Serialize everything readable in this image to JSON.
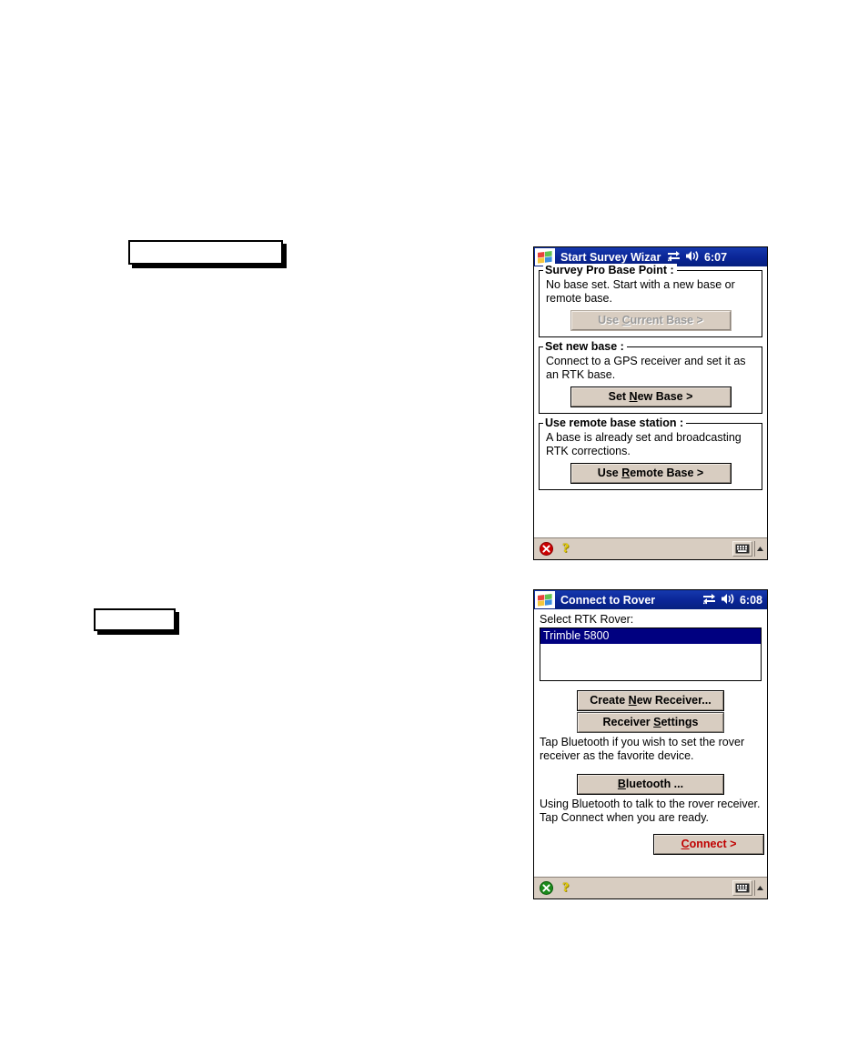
{
  "page": {
    "background_color": "#ffffff",
    "callout_boxes": [
      {
        "name": "doc-callout-box-top",
        "text": ""
      },
      {
        "name": "doc-callout-box-bottom",
        "text": ""
      }
    ]
  },
  "accent_colors": {
    "titlebar_blue": "#0a2596",
    "selection_blue": "#000080",
    "button_face": "#d8cdc1",
    "connect_red": "#c00000",
    "close_red": "#cc0000",
    "close_green": "#1b8a1b",
    "help_yellow": "#e8d100"
  },
  "windows": [
    {
      "id": "start-survey-wizard",
      "titlebar": {
        "logo_icon": "windows-flag-icon",
        "title": "Start Survey Wizar",
        "connectivity_icon": "connectivity-arrows-icon",
        "volume_icon": "speaker-icon",
        "clock": "6:07"
      },
      "groups": [
        {
          "legend": "Survey Pro Base Point :",
          "text": "No base set. Start with a new base or remote base.",
          "button": {
            "label_pre": "Use ",
            "label_accel": "C",
            "label_post": "urrent Base >",
            "full_label": "Use Current Base >",
            "disabled": true,
            "width": 175
          }
        },
        {
          "legend": "Set new base :",
          "text": "Connect to a GPS receiver and set it as an RTK base.",
          "button": {
            "label_pre": "Set ",
            "label_accel": "N",
            "label_post": "ew Base >",
            "full_label": "Set New Base >",
            "disabled": false,
            "width": 175
          }
        },
        {
          "legend": "Use remote base station :",
          "text": "A base is already set and broadcasting RTK corrections.",
          "button": {
            "label_pre": "Use ",
            "label_accel": "R",
            "label_post": "emote Base >",
            "full_label": "Use Remote Base >",
            "disabled": false,
            "width": 175
          }
        }
      ],
      "commandbar": {
        "close_icon": "close-circle-icon",
        "close_icon_color": "#cc0000",
        "help_icon": "help-question-icon",
        "sip_icon": "keyboard-icon",
        "sip_arrow_icon": "chevron-up-icon"
      }
    },
    {
      "id": "connect-to-rover",
      "titlebar": {
        "logo_icon": "windows-flag-icon",
        "title": "Connect to Rover",
        "connectivity_icon": "connectivity-arrows-icon",
        "volume_icon": "speaker-icon",
        "clock": "6:08"
      },
      "label": "Select RTK Rover:",
      "receiver_list": {
        "items": [
          {
            "label": "Trimble 5800",
            "selected": true
          }
        ]
      },
      "buttons": [
        {
          "name": "create-new-receiver-button",
          "label_pre": "Create ",
          "label_accel": "N",
          "label_post": "ew Receiver...",
          "full_label": "Create New Receiver...",
          "width": 160,
          "accent": false
        },
        {
          "name": "receiver-settings-button",
          "label_pre": "Receiver ",
          "label_accel": "S",
          "label_post": "ettings",
          "full_label": "Receiver Settings",
          "width": 160,
          "accent": false
        },
        {
          "name": "bluetooth-button",
          "label_pre": "",
          "label_accel": "B",
          "label_post": "luetooth ...",
          "full_label": "Bluetooth ...",
          "width": 160,
          "accent": false
        },
        {
          "name": "connect-button",
          "label_pre": "",
          "label_accel": "C",
          "label_post": "onnect >",
          "full_label": "Connect >",
          "width": 120,
          "accent": true
        }
      ],
      "help_text_1": "Tap Bluetooth if you wish to set the rover  receiver as the favorite device.",
      "help_text_2": "Using Bluetooth to talk to the rover receiver. Tap Connect when you are ready.",
      "commandbar": {
        "close_icon": "close-circle-icon",
        "close_icon_color": "#1b8a1b",
        "help_icon": "help-question-icon",
        "sip_icon": "keyboard-icon",
        "sip_arrow_icon": "chevron-up-icon"
      }
    }
  ]
}
